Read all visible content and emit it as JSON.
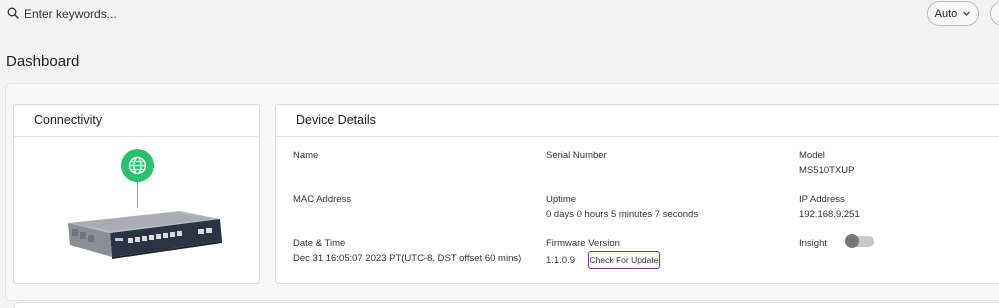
{
  "search": {
    "placeholder": "Enter keywords..."
  },
  "toolbar": {
    "auto_label": "Auto"
  },
  "page": {
    "title": "Dashboard"
  },
  "connectivity": {
    "title": "Connectivity"
  },
  "device_details": {
    "title": "Device Details",
    "name_label": "Name",
    "name_value": "",
    "serial_label": "Serial Number",
    "serial_value": "",
    "model_label": "Model",
    "model_value": "MS510TXUP",
    "mac_label": "MAC Address",
    "mac_value": "",
    "uptime_label": "Uptime",
    "uptime_value": "0 days 0 hours 5 minutes 7 seconds",
    "ip_label": "IP Address",
    "ip_value": "192.168.9.251",
    "datetime_label": "Date & Time",
    "datetime_value": "Dec 31 16:05:07 2023 PT(UTC-8, DST offset 60 mins)",
    "firmware_label": "Firmware Version",
    "firmware_value": "1.1.0.9",
    "check_update_label": "Check For Update",
    "insight_label": "Insight",
    "insight_enabled": false
  },
  "colors": {
    "accent_green": "#2fbf71",
    "update_border": "#7b3d8f",
    "toggle_off": "#c9c9c9"
  },
  "icons": {
    "search": "search-icon",
    "chevron": "chevron-down-icon",
    "globe": "globe-icon"
  }
}
